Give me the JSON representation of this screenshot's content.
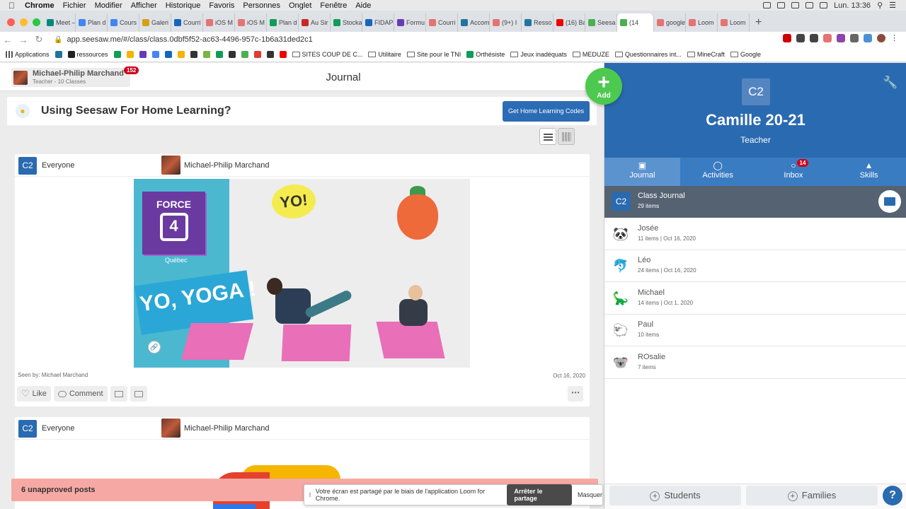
{
  "menubar": {
    "items": [
      "Chrome",
      "Fichier",
      "Modifier",
      "Afficher",
      "Historique",
      "Favoris",
      "Personnes",
      "Onglet",
      "Fenêtre",
      "Aide"
    ],
    "clock": "Lun. 13:36"
  },
  "tabs": [
    {
      "label": "Meet –",
      "color": "#00897b"
    },
    {
      "label": "Plan d",
      "color": "#4285f4"
    },
    {
      "label": "Cours",
      "color": "#4285f4"
    },
    {
      "label": "Galeri",
      "color": "#d4a017"
    },
    {
      "label": "Courri",
      "color": "#1565c0"
    },
    {
      "label": "iOS M",
      "color": "#e57373"
    },
    {
      "label": "iOS M",
      "color": "#e57373"
    },
    {
      "label": "Plan d",
      "color": "#0f9d58"
    },
    {
      "label": "Au Sir",
      "color": "#c62828"
    },
    {
      "label": "Stocka",
      "color": "#0f9d58"
    },
    {
      "label": "FIDAP",
      "color": "#1565c0"
    },
    {
      "label": "Formu",
      "color": "#673ab7"
    },
    {
      "label": "Courri",
      "color": "#e57373"
    },
    {
      "label": "Accom",
      "color": "#21759b"
    },
    {
      "label": "(9+) I",
      "color": "#e57373"
    },
    {
      "label": "Resso",
      "color": "#21759b"
    },
    {
      "label": "(16) Ba",
      "color": "#e00"
    },
    {
      "label": "Seesa",
      "color": "#4caf50"
    },
    {
      "label": "(14",
      "color": "#4caf50",
      "active": true
    },
    {
      "label": "google",
      "color": "#e57373"
    },
    {
      "label": "Loom",
      "color": "#e57373"
    },
    {
      "label": "Loom",
      "color": "#e57373"
    }
  ],
  "url": "app.seesaw.me/#/class/class.0dbf5f52-ac63-4496-957c-1b6a31ded2c1",
  "bookmarks": [
    {
      "label": "Applications",
      "type": "apps"
    },
    {
      "label": "",
      "type": "fav"
    },
    {
      "label": "ressources",
      "type": "fav"
    },
    {
      "label": "",
      "type": "fav"
    },
    {
      "label": "",
      "type": "fav"
    },
    {
      "label": "",
      "type": "fav"
    },
    {
      "label": "",
      "type": "fav"
    },
    {
      "label": "",
      "type": "fav"
    },
    {
      "label": "",
      "type": "fav"
    },
    {
      "label": "",
      "type": "fav"
    },
    {
      "label": "",
      "type": "fav"
    },
    {
      "label": "",
      "type": "fav"
    },
    {
      "label": "",
      "type": "fav"
    },
    {
      "label": "",
      "type": "fav"
    },
    {
      "label": "",
      "type": "fav"
    },
    {
      "label": "",
      "type": "fav"
    },
    {
      "label": "",
      "type": "fav"
    },
    {
      "label": "SITES COUP DE C...",
      "type": "folder"
    },
    {
      "label": "Utilitaire",
      "type": "folder"
    },
    {
      "label": "Site pour le TNI",
      "type": "folder"
    },
    {
      "label": "Orthésiste",
      "type": "fav"
    },
    {
      "label": "Jeux inadéquats",
      "type": "folder"
    },
    {
      "label": "MEDUZE",
      "type": "folder"
    },
    {
      "label": "Questionnaires int...",
      "type": "folder"
    },
    {
      "label": "MineCraft",
      "type": "folder"
    },
    {
      "label": "Google",
      "type": "folder"
    }
  ],
  "user": {
    "name": "Michael-Philip Marchand",
    "sub": "Teacher - 10 Classes",
    "notifications": "152"
  },
  "page_title": "Journal",
  "add_label": "Add",
  "banner": {
    "text": "Using Seesaw For Home Learning?",
    "button": "Get Home Learning Codes"
  },
  "posts": [
    {
      "badge": "C2",
      "audience": "Everyone",
      "author": "Michael-Philip Marchand",
      "image_text": {
        "force": "FORCE",
        "four": "4",
        "quebec": "Québec",
        "yo": "YO!",
        "yoga": "YO, YOGA !"
      },
      "seen_by": "Seen by: Michael Marchand",
      "date": "Oct 16, 2020",
      "like": "Like",
      "comment": "Comment"
    },
    {
      "badge": "C2",
      "audience": "Everyone",
      "author": "Michael-Philip Marchand"
    }
  ],
  "unapproved": "6 unapproved posts",
  "loom": {
    "message": "Votre écran est partagé par le biais de l'application Loom for Chrome.",
    "stop": "Arrêter le partage",
    "hide": "Masquer"
  },
  "class": {
    "badge": "C2",
    "name": "Camille 20-21",
    "role": "Teacher"
  },
  "side_tabs": [
    {
      "label": "Journal",
      "icon": "book-icon"
    },
    {
      "label": "Activities",
      "icon": "bulb-icon"
    },
    {
      "label": "Inbox",
      "icon": "chat-icon",
      "badge": "14"
    },
    {
      "label": "Skills",
      "icon": "cap-icon"
    }
  ],
  "students": [
    {
      "name": "Class Journal",
      "meta": "29 items",
      "avatar": "C2",
      "kind": "class"
    },
    {
      "name": "Josée",
      "meta": "11 items | Oct 16, 2020",
      "avatar": "🐼"
    },
    {
      "name": "Léo",
      "meta": "24 items | Oct 16, 2020",
      "avatar": "🐬"
    },
    {
      "name": "Michael",
      "meta": "14 items | Oct 1, 2020",
      "avatar": "🦕"
    },
    {
      "name": "Paul",
      "meta": "10 items",
      "avatar": "🐑"
    },
    {
      "name": "ROsalie",
      "meta": "7 items",
      "avatar": "🐨"
    }
  ],
  "footer": {
    "students": "Students",
    "families": "Families",
    "help": "?"
  }
}
